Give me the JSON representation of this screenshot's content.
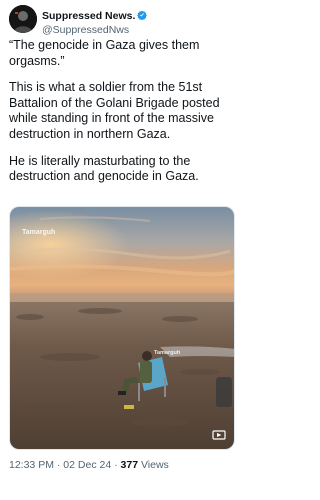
{
  "tweet": {
    "display_name": "Suppressed News.",
    "handle": "@SuppressedNws",
    "verified": true,
    "paragraphs": [
      "“The genocide in Gaza gives them orgasms.”",
      "This is what a soldier from the 51st Battalion of the Golani Brigade posted while standing in front of the massive destruction in northern Gaza.",
      "He is literally masturbating to the destruction and genocide in Gaza."
    ],
    "media": {
      "watermark_main": "Tamarguh",
      "watermark_small": "Tamarguh",
      "icon": "video-icon"
    },
    "footer": {
      "time": "12:33 PM",
      "date": "02 Dec 24",
      "separator": "·",
      "views_count": "377",
      "views_label": "Views"
    }
  },
  "colors": {
    "verified": "#1d9bf0",
    "text": "#0f1419",
    "secondary": "#536471"
  }
}
